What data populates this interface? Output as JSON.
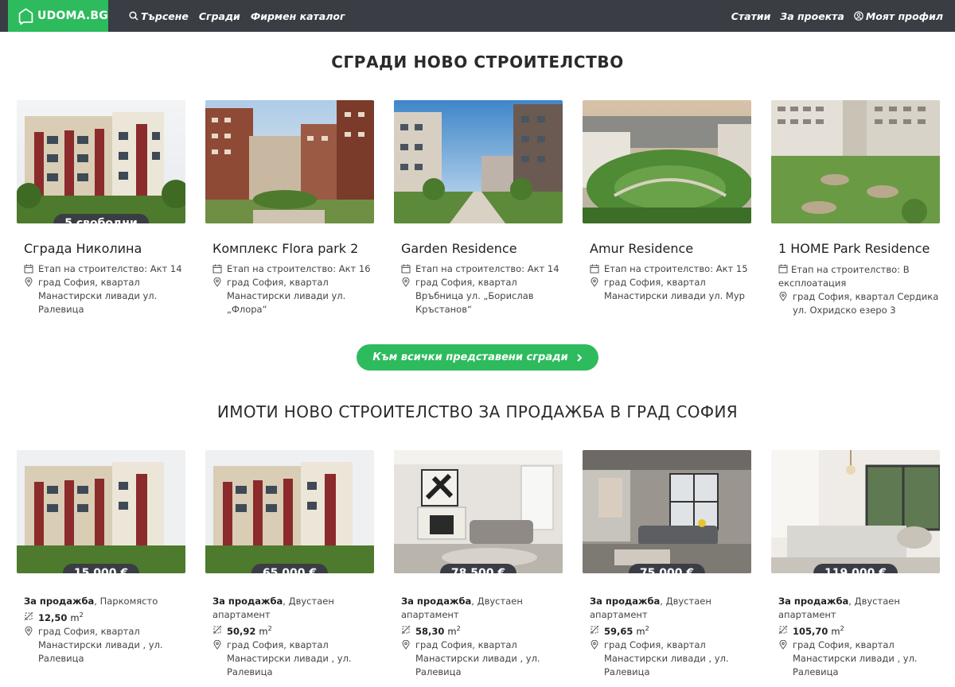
{
  "nav": {
    "logo_text": "UDOMA.BG",
    "left": [
      "Търсене",
      "Сгради",
      "Фирмен каталог"
    ],
    "right": [
      "Статии",
      "За проекта",
      "Моят профил"
    ]
  },
  "section1": {
    "title": "СГРАДИ НОВО СТРОИТЕЛСТВО",
    "cards": [
      {
        "name": "Сграда Николина",
        "badge": "5 свободни",
        "stage": "Етап на строителство: Акт 14",
        "address": "град София, квартал Манастирски ливади ул. Ралевица"
      },
      {
        "name": "Комплекс Flora park 2",
        "badge": "",
        "stage": "Етап на строителство: Акт 16",
        "address": "град София, квартал Манастирски ливади ул. „Флора“"
      },
      {
        "name": "Garden Residence",
        "badge": "",
        "stage": "Етап на строителство: Акт 14",
        "address": "град София, квартал Връбница ул. „Борислав Кръстанов“"
      },
      {
        "name": "Amur Residence",
        "badge": "",
        "stage": "Етап на строителство: Акт 15",
        "address": "град София, квартал Манастирски ливади ул. Мур"
      },
      {
        "name": "1 HOME Park Residence",
        "badge": "",
        "stage": "Етап на строителство: В експлоатация",
        "address": "град София, квартал Сердика ул. Охридско езеро 3"
      }
    ],
    "cta": "Към всички представени сгради"
  },
  "section2": {
    "title": "ИМОТИ НОВО СТРОИТЕЛСТВО ЗА ПРОДАЖБА В ГРАД СОФИЯ",
    "sale_label": "За продажба",
    "area_unit": "m",
    "cards": [
      {
        "price": "15 000 €",
        "type": "Паркомясто",
        "area": "12,50",
        "address": "град София, квартал Манастирски ливади , ул. Ралевица"
      },
      {
        "price": "65 000 €",
        "type": "Двустаен апартамент",
        "area": "50,92",
        "address": "град София, квартал Манастирски ливади , ул. Ралевица"
      },
      {
        "price": "78 500 €",
        "type": "Двустаен апартамент",
        "area": "58,30",
        "address": "град София, квартал Манастирски ливади , ул. Ралевица"
      },
      {
        "price": "75 000 €",
        "type": "Двустаен апартамент",
        "area": "59,65",
        "address": "град София, квартал Манастирски ливади , ул. Ралевица"
      },
      {
        "price": "119 000 €",
        "type": "Двустаен апартамент",
        "area": "105,70",
        "address": "град София, квартал Манастирски ливади , ул. Ралевица"
      }
    ]
  },
  "colors": {
    "brand_green": "#2dbb5d",
    "nav_dark": "#3a3d44"
  }
}
